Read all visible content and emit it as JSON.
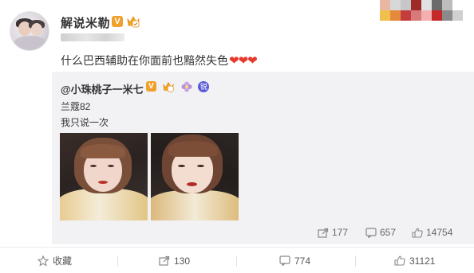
{
  "post": {
    "username": "解说米勒",
    "verified_badge": "V",
    "content": "什么巴西辅助在你面前也黯然失色",
    "hearts": "❤❤❤"
  },
  "repost": {
    "username": "@小珠桃子一米七",
    "verified_badge": "V",
    "badge_extra": "锐",
    "line1": "兰蔻82",
    "line2": "我只说一次",
    "stats": {
      "reposts": "177",
      "comments": "657",
      "likes": "14754"
    }
  },
  "bottom_bar": {
    "favorite_label": "收藏",
    "reposts": "130",
    "comments": "774",
    "likes": "31121"
  },
  "colors": {
    "accent_orange": "#f0a12b",
    "heart_red": "#e8392d",
    "repost_bg": "#f2f2f5"
  },
  "icons": [
    "crown-icon",
    "flower-icon",
    "repost-icon",
    "comment-icon",
    "like-icon",
    "favorite-icon"
  ]
}
